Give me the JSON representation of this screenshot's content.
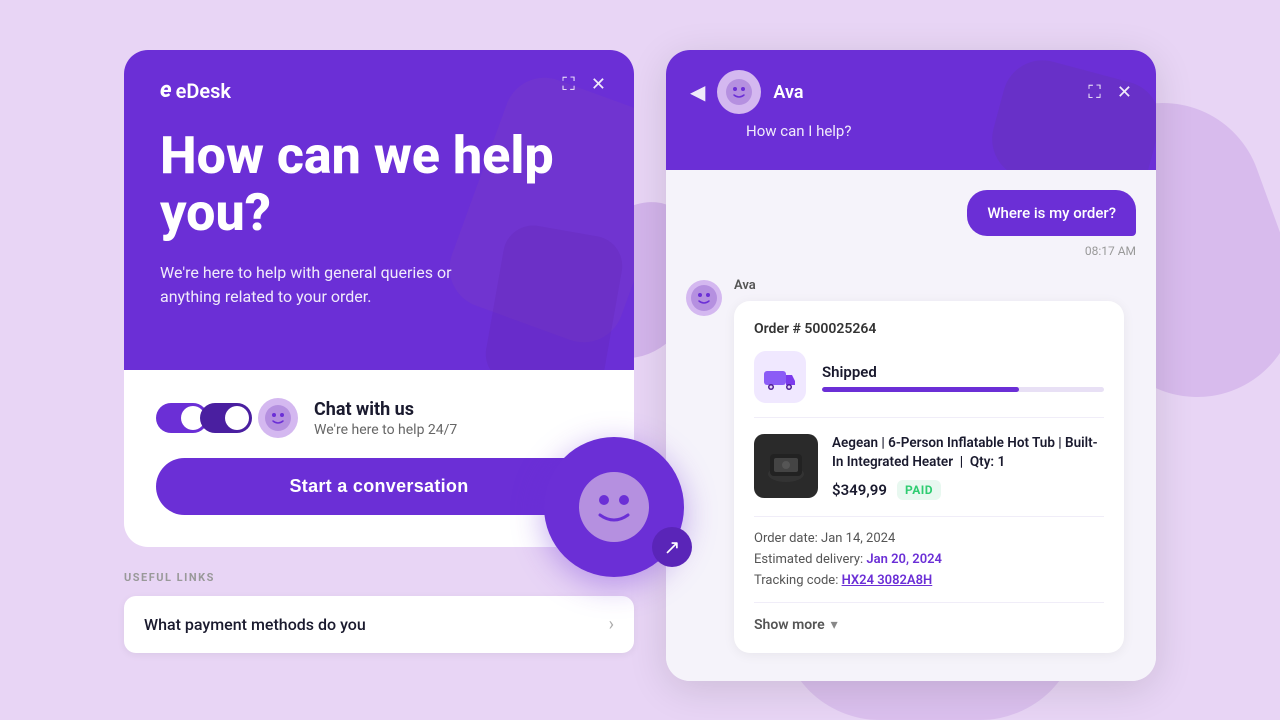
{
  "background": {
    "color": "#e8d5f5"
  },
  "left_panel": {
    "logo": "eDesk",
    "controls": {
      "expand": "⛶",
      "close": "✕"
    },
    "hero": {
      "title": "How can we help you?",
      "subtitle": "We're here to help with general queries or anything related to your order."
    },
    "chat_option": {
      "title": "Chat with us",
      "subtitle": "We're here to help 24/7"
    },
    "cta_button": "Start a conversation",
    "useful_links": {
      "label": "USEFUL LINKS",
      "items": [
        {
          "text": "What payment methods do you"
        }
      ]
    }
  },
  "right_panel": {
    "header": {
      "back_icon": "◀",
      "agent_name": "Ava",
      "status_text": "How can I help?",
      "expand_icon": "⛶",
      "close_icon": "✕"
    },
    "messages": [
      {
        "type": "user",
        "text": "Where is my order?",
        "time": "08:17 AM"
      },
      {
        "type": "bot",
        "sender": "Ava",
        "order": {
          "number": "Order # 500025264",
          "status": "Shipped",
          "progress": 70,
          "product_name": "Aegean | 6-Person Inflatable Hot Tub | Built-In Integrated Heater",
          "qty": "Qty: 1",
          "price": "$349,99",
          "paid_label": "PAID",
          "order_date_label": "Order date:",
          "order_date": "Jan 14, 2024",
          "delivery_label": "Estimated delivery:",
          "delivery_date": "Jan 20, 2024",
          "tracking_label": "Tracking code:",
          "tracking_code": "HX24 3082A8H",
          "show_more": "Show more"
        }
      }
    ]
  }
}
